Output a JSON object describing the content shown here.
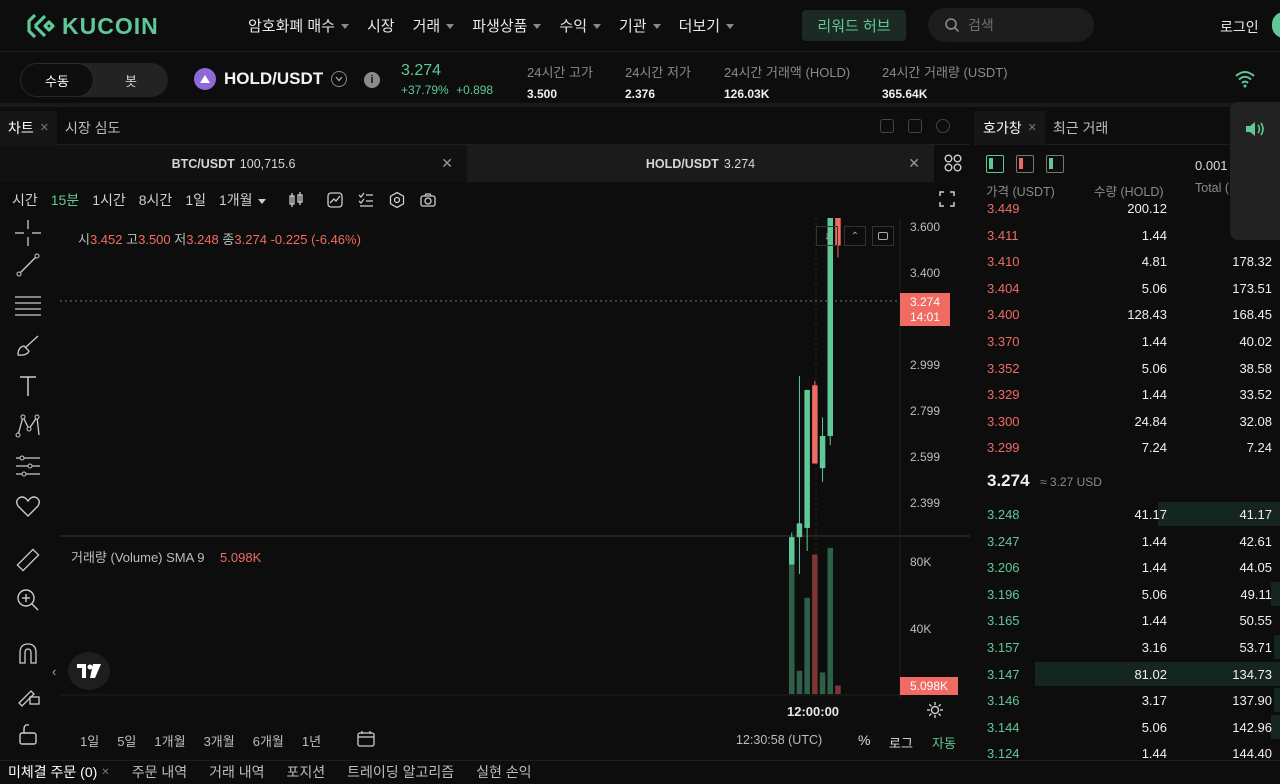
{
  "brand": {
    "name": "KUCOIN",
    "accent": "#60c896"
  },
  "nav": {
    "items": [
      {
        "label": "암호화폐 매수",
        "has_caret": true
      },
      {
        "label": "시장",
        "has_caret": false
      },
      {
        "label": "거래",
        "has_caret": true
      },
      {
        "label": "파생상품",
        "has_caret": true
      },
      {
        "label": "수익",
        "has_caret": true
      },
      {
        "label": "기관",
        "has_caret": true
      },
      {
        "label": "더보기",
        "has_caret": true
      }
    ],
    "reward_hub": "리워드 허브",
    "search_placeholder": "검색",
    "login": "로그인"
  },
  "ticker": {
    "mode_manual": "수동",
    "mode_bot": "봇",
    "pair": "HOLD/USDT",
    "last_price": "3.274",
    "change_pct": "+37.79%",
    "change_abs": "+0.898",
    "stats": [
      {
        "label": "24시간 고가",
        "value": "3.500"
      },
      {
        "label": "24시간 저가",
        "value": "2.376"
      },
      {
        "label": "24시간 거래액 (HOLD)",
        "value": "126.03K"
      },
      {
        "label": "24시간 거래량 (USDT)",
        "value": "365.64K"
      }
    ]
  },
  "chart_panel": {
    "tabs": [
      {
        "label": "차트",
        "closable": true
      },
      {
        "label": "시장 심도",
        "closable": false
      }
    ],
    "pair_tabs": [
      {
        "pair": "BTC/USDT",
        "price": "100,715.6"
      },
      {
        "pair": "HOLD/USDT",
        "price": "3.274"
      }
    ],
    "intervals": [
      {
        "label": "시간",
        "active": false
      },
      {
        "label": "15분",
        "active": true
      },
      {
        "label": "1시간",
        "active": false
      },
      {
        "label": "8시간",
        "active": false
      },
      {
        "label": "1일",
        "active": false
      },
      {
        "label": "1개월",
        "active": false
      }
    ],
    "ohlc": {
      "o_lbl": "시",
      "o": "3.452",
      "h_lbl": "고",
      "h": "3.500",
      "l_lbl": "저",
      "l": "3.248",
      "c_lbl": "종",
      "c": "3.274",
      "chg": "-0.225",
      "chg_pct": "(-6.46%)"
    },
    "volume_label": "거래량 (Volume) SMA 9",
    "volume_value": "5.098K",
    "price_tag": "3.274",
    "price_tag_timer": "14:01",
    "time_label": "12:00:00",
    "ranges": [
      "1일",
      "5일",
      "1개월",
      "3개월",
      "6개월",
      "1년"
    ],
    "clock": "12:30:58 (UTC)",
    "pct_btn": "%",
    "log_btn": "로그",
    "auto_btn": "자동"
  },
  "chart_data": {
    "type": "candlestick",
    "price_ticks": [
      "3.600",
      "3.400",
      "2.999",
      "2.799",
      "2.599",
      "2.399"
    ],
    "volume_ticks": [
      "80K",
      "40K"
    ],
    "candles": [
      {
        "o": 2.4,
        "h": 2.65,
        "l": 2.38,
        "c": 2.64,
        "dir": "up"
      },
      {
        "o": 2.64,
        "h": 2.99,
        "l": 2.56,
        "c": 2.67,
        "dir": "up"
      },
      {
        "o": 2.66,
        "h": 2.92,
        "l": 2.61,
        "c": 2.96,
        "dir": "up"
      },
      {
        "o": 2.97,
        "h": 2.98,
        "l": 2.8,
        "c": 2.8,
        "dir": "down"
      },
      {
        "o": 2.79,
        "h": 2.9,
        "l": 2.76,
        "c": 2.86,
        "dir": "up"
      },
      {
        "o": 2.86,
        "h": 3.5,
        "l": 2.84,
        "c": 3.49,
        "dir": "up"
      },
      {
        "o": 3.452,
        "h": 3.5,
        "l": 3.248,
        "c": 3.274,
        "dir": "down"
      }
    ],
    "volumes": [
      78,
      14,
      58,
      84,
      13,
      88,
      5.098
    ]
  },
  "orderbook": {
    "tabs": [
      "호가창",
      "최근 거래"
    ],
    "precision": "0.001",
    "headers": {
      "price": "가격 (USDT)",
      "qty": "수량 (HOLD)",
      "total": "Total ("
    },
    "asks": [
      {
        "p": "3.449",
        "q": "200.12",
        "t": ""
      },
      {
        "p": "3.411",
        "q": "1.44",
        "t": ""
      },
      {
        "p": "3.410",
        "q": "4.81",
        "t": "178.32"
      },
      {
        "p": "3.404",
        "q": "5.06",
        "t": "173.51"
      },
      {
        "p": "3.400",
        "q": "128.43",
        "t": "168.45"
      },
      {
        "p": "3.370",
        "q": "1.44",
        "t": "40.02"
      },
      {
        "p": "3.352",
        "q": "5.06",
        "t": "38.58"
      },
      {
        "p": "3.329",
        "q": "1.44",
        "t": "33.52"
      },
      {
        "p": "3.300",
        "q": "24.84",
        "t": "32.08"
      },
      {
        "p": "3.299",
        "q": "7.24",
        "t": "7.24"
      }
    ],
    "mid": {
      "price": "3.274",
      "usd": "≈ 3.27 USD"
    },
    "bids": [
      {
        "p": "3.248",
        "q": "41.17",
        "t": "41.17",
        "depth": 0.4
      },
      {
        "p": "3.247",
        "q": "1.44",
        "t": "42.61",
        "depth": 0.0
      },
      {
        "p": "3.206",
        "q": "1.44",
        "t": "44.05",
        "depth": 0.0
      },
      {
        "p": "3.196",
        "q": "5.06",
        "t": "49.11",
        "depth": 0.03
      },
      {
        "p": "3.165",
        "q": "1.44",
        "t": "50.55",
        "depth": 0.0
      },
      {
        "p": "3.157",
        "q": "3.16",
        "t": "53.71",
        "depth": 0.02
      },
      {
        "p": "3.147",
        "q": "81.02",
        "t": "134.73",
        "depth": 0.8
      },
      {
        "p": "3.146",
        "q": "3.17",
        "t": "137.90",
        "depth": 0.02
      },
      {
        "p": "3.144",
        "q": "5.06",
        "t": "142.96",
        "depth": 0.03
      },
      {
        "p": "3.124",
        "q": "1.44",
        "t": "144.40",
        "depth": 0.0
      }
    ]
  },
  "bottom_tabs": [
    {
      "label": "미체결 주문 (0)",
      "closable": true
    },
    {
      "label": "주문 내역",
      "closable": false
    },
    {
      "label": "거래 내역",
      "closable": false
    },
    {
      "label": "포지션",
      "closable": false
    },
    {
      "label": "트레이딩 알고리즘",
      "closable": false
    },
    {
      "label": "실현 손익",
      "closable": false
    }
  ]
}
